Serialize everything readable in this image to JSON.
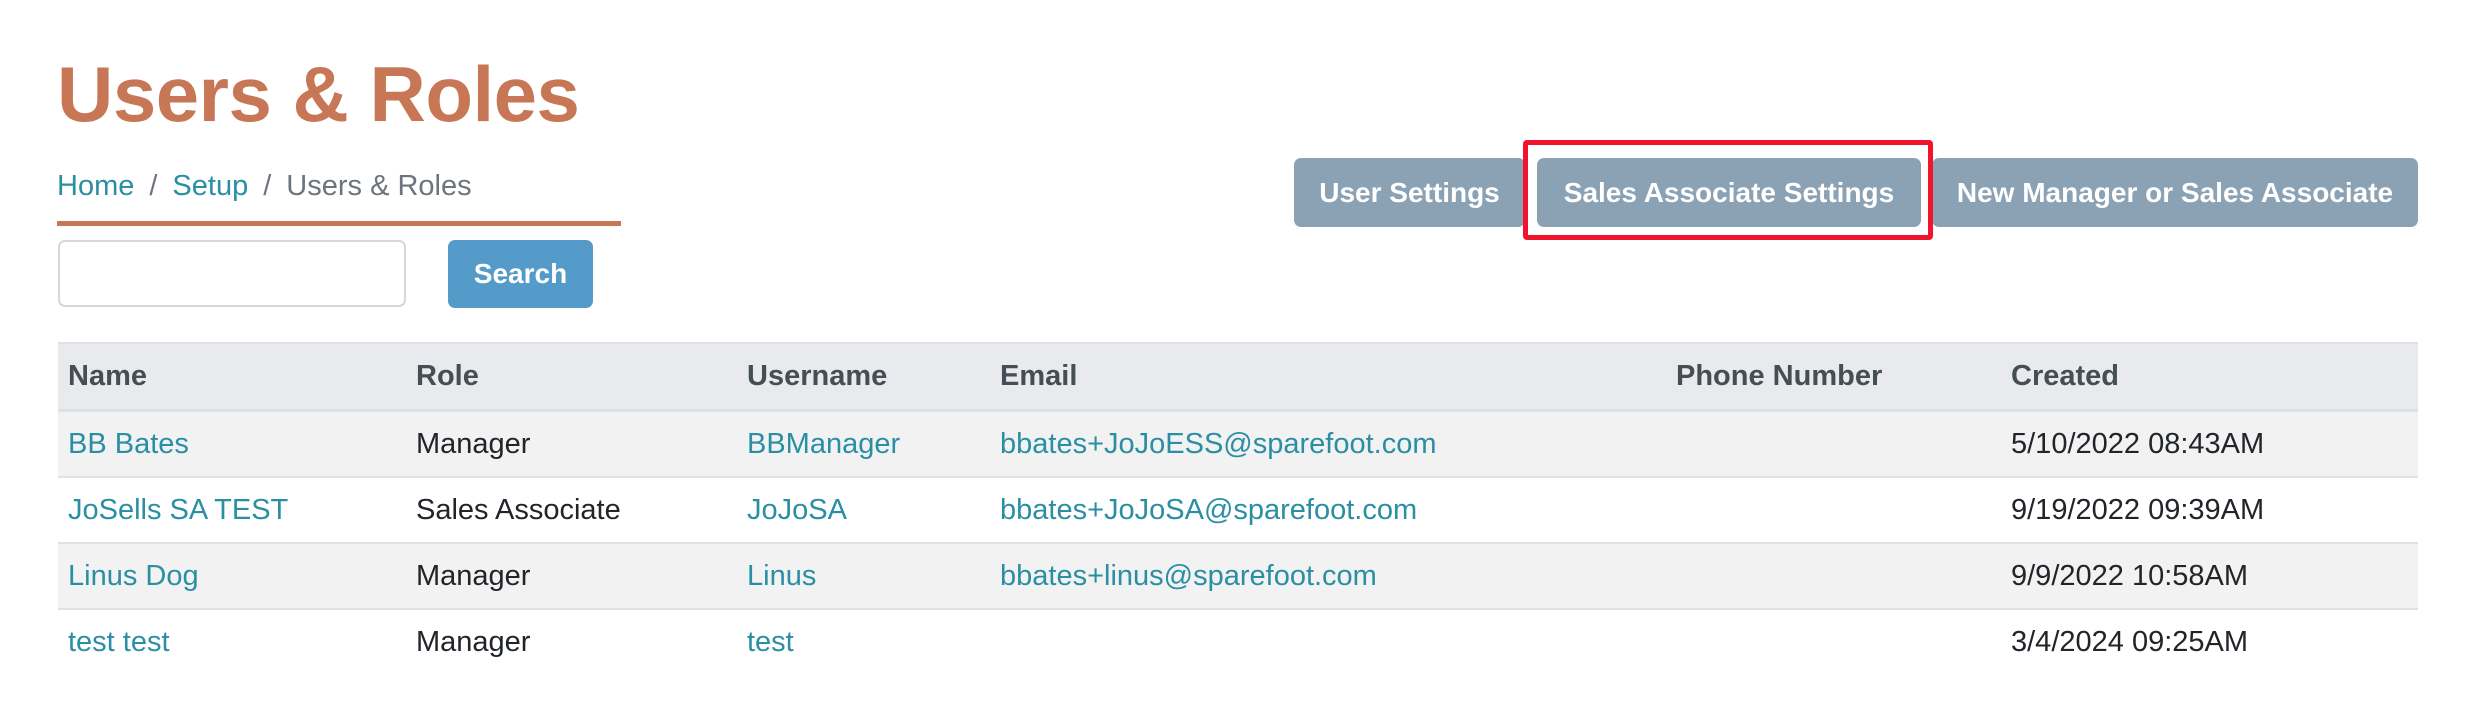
{
  "page": {
    "title": "Users & Roles"
  },
  "breadcrumb": {
    "items": [
      {
        "label": "Home",
        "link": true
      },
      {
        "label": "Setup",
        "link": true
      },
      {
        "label": "Users & Roles",
        "link": false
      }
    ],
    "separator": "/"
  },
  "search": {
    "value": "",
    "placeholder": "",
    "button_label": "Search"
  },
  "actions": {
    "user_settings_label": "User Settings",
    "sales_associate_settings_label": "Sales Associate Settings",
    "new_manager_label": "New Manager or Sales Associate",
    "highlighted": "Sales Associate Settings"
  },
  "colors": {
    "title": "#c87756",
    "link": "#2a8fa3",
    "search_button": "#549bc9",
    "action_button": "#8ba2b4",
    "highlight": "#f0142d"
  },
  "table": {
    "columns": [
      "Name",
      "Role",
      "Username",
      "Email",
      "Phone Number",
      "Created"
    ],
    "rows": [
      {
        "name": "BB Bates",
        "role": "Manager",
        "username": "BBManager",
        "email": "bbates+JoJoESS@sparefoot.com",
        "phone": "",
        "created": "5/10/2022 08:43AM"
      },
      {
        "name": "JoSells SA TEST",
        "role": "Sales Associate",
        "username": "JoJoSA",
        "email": "bbates+JoJoSA@sparefoot.com",
        "phone": "",
        "created": "9/19/2022 09:39AM"
      },
      {
        "name": "Linus Dog",
        "role": "Manager",
        "username": "Linus",
        "email": "bbates+linus@sparefoot.com",
        "phone": "",
        "created": "9/9/2022 10:58AM"
      },
      {
        "name": "test test",
        "role": "Manager",
        "username": "test",
        "email": "",
        "phone": "",
        "created": "3/4/2024 09:25AM"
      }
    ]
  }
}
